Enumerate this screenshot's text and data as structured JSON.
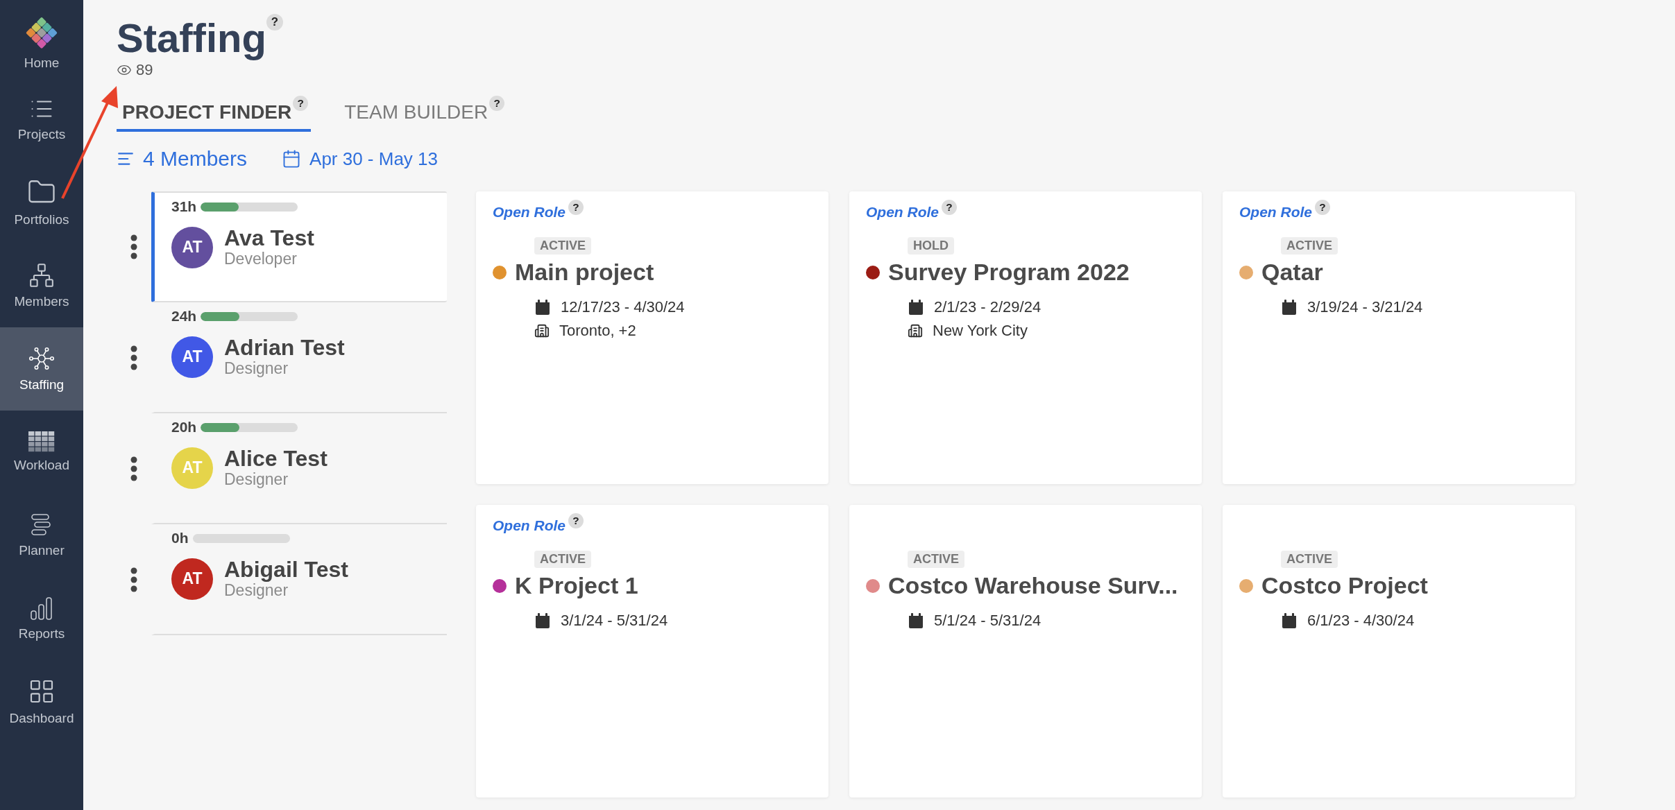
{
  "sidebar": {
    "items": [
      {
        "kind": "logo",
        "label": "Home",
        "selected": false
      },
      {
        "kind": "list",
        "label": "Projects",
        "selected": false
      },
      {
        "kind": "folder",
        "label": "Portfolios",
        "selected": false
      },
      {
        "kind": "org",
        "label": "Members",
        "selected": false
      },
      {
        "kind": "hub",
        "label": "Staffing",
        "selected": true
      },
      {
        "kind": "grid",
        "label": "Workload",
        "selected": false
      },
      {
        "kind": "planner",
        "label": "Planner",
        "selected": false
      },
      {
        "kind": "bars",
        "label": "Reports",
        "selected": false
      },
      {
        "kind": "dashboard",
        "label": "Dashboard",
        "selected": false
      }
    ]
  },
  "header": {
    "title": "Staffing",
    "help": "?",
    "views": "89"
  },
  "tabs": [
    {
      "label": "PROJECT FINDER",
      "help": "?",
      "selected": true
    },
    {
      "label": "TEAM BUILDER",
      "help": "?",
      "selected": false
    }
  ],
  "toolbar": {
    "members": "4 Members",
    "date_range": "Apr 30 - May 13"
  },
  "members": [
    {
      "hours": "31h",
      "level": 0.39,
      "initials": "AT",
      "color": "#634f9e",
      "name": "Ava Test",
      "role": "Developer",
      "selected": true
    },
    {
      "hours": "24h",
      "level": 0.4,
      "initials": "AT",
      "color": "#4158e6",
      "name": "Adrian Test",
      "role": "Designer",
      "selected": false
    },
    {
      "hours": "20h",
      "level": 0.4,
      "initials": "AT",
      "color": "#e5d44a",
      "name": "Alice Test",
      "role": "Designer",
      "selected": false
    },
    {
      "hours": "0h",
      "initials": "AT",
      "color": "#c0281f",
      "name": "Abigail Test",
      "role": "Designer",
      "selected": false
    }
  ],
  "projects": [
    {
      "open_role": "Open Role",
      "help": "?",
      "status": "ACTIVE",
      "color": "#e0922f",
      "name": "Main project",
      "dates": "12/17/23 - 4/30/24",
      "location": "Toronto, +2"
    },
    {
      "open_role": "Open Role",
      "help": "?",
      "status": "HOLD",
      "color": "#9b1c14",
      "name": "Survey Program 2022",
      "dates": "2/1/23 - 2/29/24",
      "location": "New York City"
    },
    {
      "open_role": "Open Role",
      "help": "?",
      "status": "ACTIVE",
      "color": "#e6ad70",
      "name": "Qatar",
      "dates": "3/19/24 - 3/21/24"
    },
    {
      "open_role": "Open Role",
      "help": "?",
      "status": "ACTIVE",
      "color": "#b5309a",
      "name": "K Project 1",
      "dates": "3/1/24 - 5/31/24"
    },
    {
      "status": "ACTIVE",
      "color": "#e08a8a",
      "name": "Costco Warehouse Surv...",
      "dates": "5/1/24 - 5/31/24"
    },
    {
      "status": "ACTIVE",
      "color": "#e6ad70",
      "name": "Costco Project",
      "dates": "6/1/23 - 4/30/24"
    }
  ]
}
